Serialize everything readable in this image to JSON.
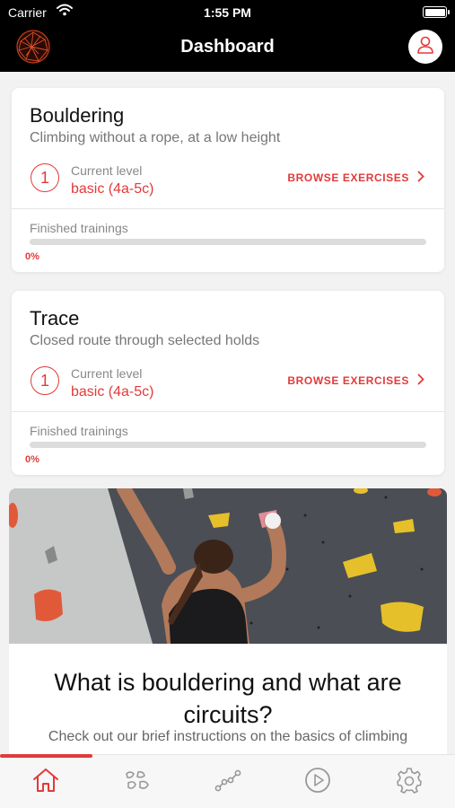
{
  "status_bar": {
    "carrier": "Carrier",
    "time": "1:55 PM"
  },
  "nav": {
    "title": "Dashboard"
  },
  "cards": [
    {
      "title": "Bouldering",
      "subtitle": "Climbing without a rope, at a low height",
      "level_number": "1",
      "level_caption": "Current level",
      "level_value": "basic (4a-5c)",
      "browse_label": "BROWSE EXERCISES",
      "progress_label": "Finished trainings",
      "progress_value": "0%",
      "progress_fraction": 0
    },
    {
      "title": "Trace",
      "subtitle": "Closed route through selected holds",
      "level_number": "1",
      "level_caption": "Current level",
      "level_value": "basic (4a-5c)",
      "browse_label": "BROWSE EXERCISES",
      "progress_label": "Finished trainings",
      "progress_value": "0%",
      "progress_fraction": 0
    }
  ],
  "promo": {
    "title": "What is bouldering and what are circuits?",
    "subtitle": "Check out our brief instructions on the basics of climbing"
  },
  "tabs": [
    {
      "icon": "home-icon",
      "active": true
    },
    {
      "icon": "holds-icon",
      "active": false
    },
    {
      "icon": "route-icon",
      "active": false
    },
    {
      "icon": "play-icon",
      "active": false
    },
    {
      "icon": "gear-icon",
      "active": false
    }
  ],
  "colors": {
    "accent": "#e23a3a",
    "bar": "#000000",
    "background": "#f2f2f2"
  }
}
